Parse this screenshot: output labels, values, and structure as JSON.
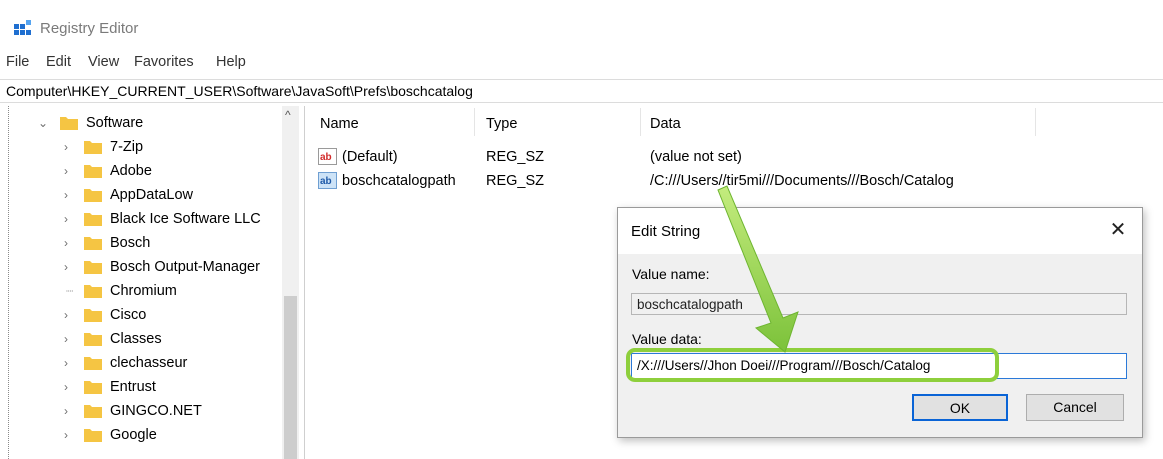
{
  "window": {
    "title": "Registry Editor"
  },
  "menu": {
    "items": [
      "File",
      "Edit",
      "View",
      "Favorites",
      "Help"
    ]
  },
  "address": {
    "path": "Computer\\HKEY_CURRENT_USER\\Software\\JavaSoft\\Prefs\\boschcatalog"
  },
  "tree": {
    "items": [
      {
        "label": "Software",
        "expanded": true
      },
      {
        "label": "7-Zip"
      },
      {
        "label": "Adobe"
      },
      {
        "label": "AppDataLow"
      },
      {
        "label": "Black Ice Software LLC"
      },
      {
        "label": "Bosch"
      },
      {
        "label": "Bosch Output-Manager"
      },
      {
        "label": "Chromium"
      },
      {
        "label": "Cisco"
      },
      {
        "label": "Classes"
      },
      {
        "label": "clechasseur"
      },
      {
        "label": "Entrust"
      },
      {
        "label": "GINGCO.NET"
      },
      {
        "label": "Google"
      }
    ]
  },
  "list": {
    "columns": [
      "Name",
      "Type",
      "Data"
    ],
    "rows": [
      {
        "name": "(Default)",
        "type": "REG_SZ",
        "data": "(value not set)",
        "icon": "string-value-icon"
      },
      {
        "name": "boschcatalogpath",
        "type": "REG_SZ",
        "data": "/C:///Users//tir5mi///Documents///Bosch/Catalog",
        "icon": "string-value-icon"
      }
    ]
  },
  "dialog": {
    "title": "Edit String",
    "value_name_label": "Value name:",
    "value_name": "boschcatalogpath",
    "value_data_label": "Value data:",
    "value_data": "/X:///Users//Jhon Doei///Program///Bosch/Catalog",
    "ok_label": "OK",
    "cancel_label": "Cancel",
    "close_glyph": "✕"
  },
  "colors": {
    "highlight": "#8ecf3c",
    "folder": "#f5c543",
    "accent": "#0a64d6"
  }
}
